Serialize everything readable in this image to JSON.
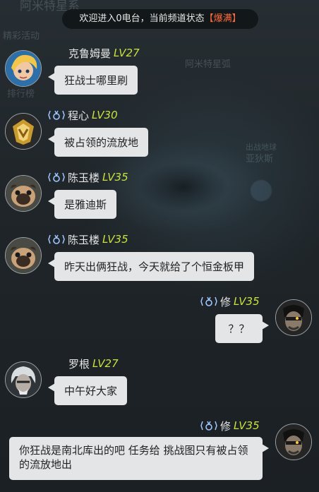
{
  "banner": {
    "prefix": "欢迎进入0电台，当前频道状态",
    "status": "【爆满】"
  },
  "background_labels": [
    "阿米特星系",
    "精彩活动",
    "排行榜",
    "阿米特星弧",
    "亚狄斯",
    "出战地球"
  ],
  "messages": [
    {
      "name": "克鲁姆曼",
      "level": "LV27",
      "badge": false,
      "side": "left",
      "text": "狂战士哪里刷",
      "avatar": "blonde-hero-avatar"
    },
    {
      "name": "程心",
      "level": "LV30",
      "badge": true,
      "side": "left",
      "text": "被占领的流放地",
      "avatar": "gold-crest-avatar"
    },
    {
      "name": "陈玉楼",
      "level": "LV35",
      "badge": true,
      "side": "left",
      "text": "是雅迪斯",
      "avatar": "pug-avatar"
    },
    {
      "name": "陈玉楼",
      "level": "LV35",
      "badge": true,
      "side": "left",
      "text": "昨天出俩狂战，今天就给了个恒金板甲",
      "avatar": "pug-avatar"
    },
    {
      "name": "修",
      "level": "LV35",
      "badge": true,
      "side": "right",
      "text": "？？",
      "avatar": "dark-warrior-avatar"
    },
    {
      "name": "罗根",
      "level": "LV27",
      "badge": false,
      "side": "left",
      "text": "中午好大家",
      "avatar": "white-hair-avatar"
    },
    {
      "name": "修",
      "level": "LV35",
      "badge": true,
      "side": "right",
      "text": "你狂战是南北库出的吧 任务给 挑战图只有被占领的流放地出",
      "avatar": "dark-warrior-avatar"
    }
  ],
  "colors": {
    "level": "#c9e23d",
    "status": "#ff6a3c",
    "bubble": "#e3e5e6"
  }
}
